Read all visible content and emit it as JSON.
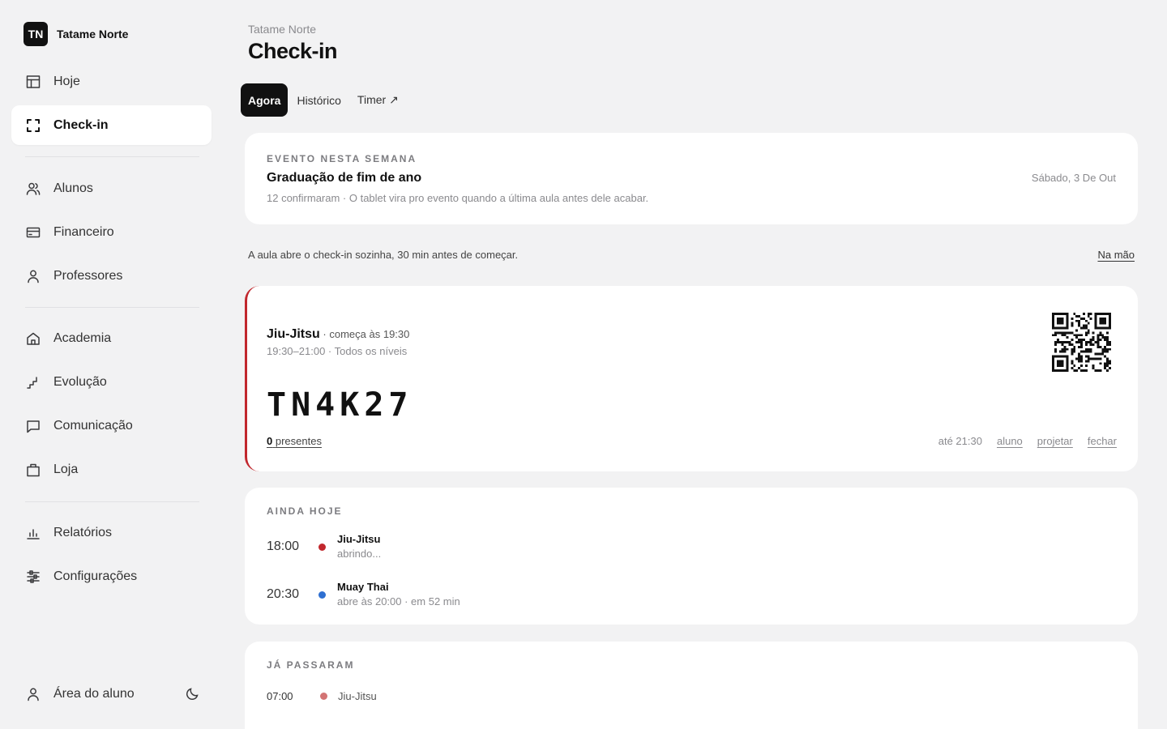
{
  "brand": {
    "logo": "TN",
    "name": "Tatame Norte"
  },
  "nav": {
    "items": [
      {
        "label": "Hoje",
        "icon": "layout-icon"
      },
      {
        "label": "Check-in",
        "icon": "scan-icon"
      },
      {
        "label": "Alunos",
        "icon": "users-icon"
      },
      {
        "label": "Financeiro",
        "icon": "credit-card-icon"
      },
      {
        "label": "Professores",
        "icon": "user-icon"
      },
      {
        "label": "Academia",
        "icon": "home-icon"
      },
      {
        "label": "Evolução",
        "icon": "stairs-icon"
      },
      {
        "label": "Comunicação",
        "icon": "message-icon"
      },
      {
        "label": "Loja",
        "icon": "bag-icon"
      },
      {
        "label": "Relatórios",
        "icon": "bar-chart-icon"
      },
      {
        "label": "Configurações",
        "icon": "sliders-icon"
      }
    ],
    "active": "Check-in",
    "footer": {
      "label": "Área do aluno",
      "icon": "user-icon",
      "theme_icon": "moon-icon"
    }
  },
  "header": {
    "eyebrow": "Tatame Norte",
    "title": "Check-in"
  },
  "tabs": [
    {
      "label": "Agora",
      "active": true
    },
    {
      "label": "Histórico",
      "active": false
    },
    {
      "label": "Timer ↗",
      "active": false
    }
  ],
  "event": {
    "section": "EVENTO NESTA SEMANA",
    "title": "Graduação de fim de ano",
    "subtitle": "12 confirmaram · O tablet vira pro evento quando a última aula antes dele acabar.",
    "date": "Sábado, 3 De Out"
  },
  "notice": {
    "text": "A aula abre o check-in sozinha, 30 min antes de começar.",
    "link": "Na mão"
  },
  "current_class": {
    "name": "Jiu-Jitsu",
    "starts": "· começa às 19:30",
    "meta": "19:30–21:00 · Todos os níveis",
    "code": "TN4K27",
    "present_count": "0",
    "present_label": "presentes",
    "until": "até 21:30",
    "actions": [
      "aluno",
      "projetar",
      "fechar"
    ],
    "accent_color": "#c1272d"
  },
  "today": {
    "section": "AINDA HOJE",
    "rows": [
      {
        "time": "18:00",
        "name": "Jiu-Jitsu",
        "status": "abrindo...",
        "color": "#c1272d"
      },
      {
        "time": "20:30",
        "name": "Muay Thai",
        "status": "abre às 20:00 · em 52 min",
        "color": "#2f6fd1"
      }
    ]
  },
  "past": {
    "section": "JÁ PASSARAM",
    "rows": [
      {
        "time": "07:00",
        "name": "Jiu-Jitsu",
        "color": "#d37474"
      }
    ]
  }
}
